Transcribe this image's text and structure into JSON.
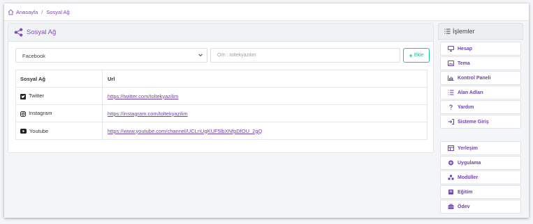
{
  "breadcrumb": {
    "home": "Anasayfa",
    "separator": "/",
    "current": "Sosyal Ağ"
  },
  "card": {
    "title": "Sosyal Ağ"
  },
  "form": {
    "selected_network": "Facebook",
    "url_placeholder": "Örn : toltekyazilim",
    "add_label": "Ekle"
  },
  "table": {
    "headers": {
      "network": "Sosyal Ağ",
      "url": "Url"
    },
    "rows": [
      {
        "network": "Twitter",
        "icon": "twitter-icon",
        "url": "https://twitter.com/toltekyazilim"
      },
      {
        "network": "Instagram",
        "icon": "instagram-icon",
        "url": "https://instagram.com/toltekyazilim"
      },
      {
        "network": "Youtube",
        "icon": "youtube-icon",
        "url": "https://www.youtube.com/channel/UCLnUgKUF5lbXNfpDfOU_2gQ"
      }
    ]
  },
  "sidebar": {
    "title": "İşlemler",
    "group1": [
      {
        "label": "Hesap",
        "icon": "monitor-icon"
      },
      {
        "label": "Tema",
        "icon": "image-icon"
      },
      {
        "label": "Kontrol Paneli",
        "icon": "chart-icon"
      },
      {
        "label": "Alan Adları",
        "icon": "list-icon"
      },
      {
        "label": "Yardım",
        "icon": "question-icon"
      },
      {
        "label": "Sisteme Giriş",
        "icon": "login-icon"
      }
    ],
    "group2": [
      {
        "label": "Yerleşim",
        "icon": "layout-icon"
      },
      {
        "label": "Uygulama",
        "icon": "app-icon"
      },
      {
        "label": "Modüller",
        "icon": "modules-icon"
      },
      {
        "label": "Eğitim",
        "icon": "book-icon"
      },
      {
        "label": "Ödev",
        "icon": "briefcase-icon"
      }
    ]
  },
  "colors": {
    "accent": "#7c4fb8",
    "link": "#6f42b0",
    "add_button": "#1fb899"
  }
}
